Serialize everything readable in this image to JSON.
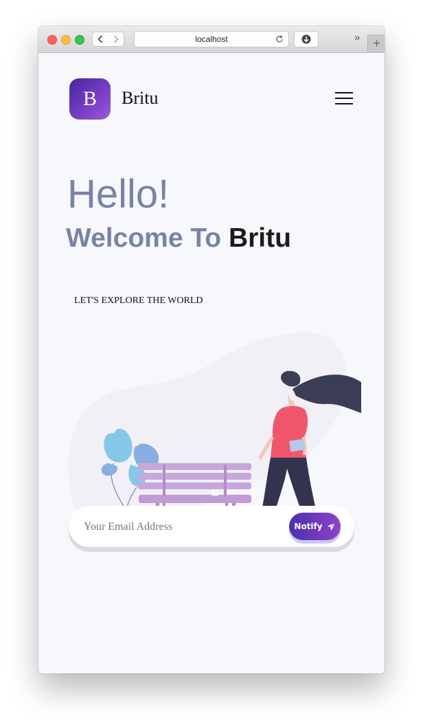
{
  "browser": {
    "url": "localhost",
    "more_label": "»",
    "new_tab_label": "+"
  },
  "header": {
    "logo_letter": "B",
    "brand_name": "Britu"
  },
  "hero": {
    "hello": "Hello!",
    "welcome_prefix": "Welcome To ",
    "welcome_brand": "Britu",
    "tagline": "LET'S EXPLORE THE WORLD"
  },
  "subscribe": {
    "placeholder": "Your Email Address",
    "button_label": "Notify"
  },
  "colors": {
    "accent_start": "#4a2fb0",
    "accent_end": "#8e44c7",
    "heading": "#7883a6",
    "page_bg": "#f7f8fc"
  }
}
